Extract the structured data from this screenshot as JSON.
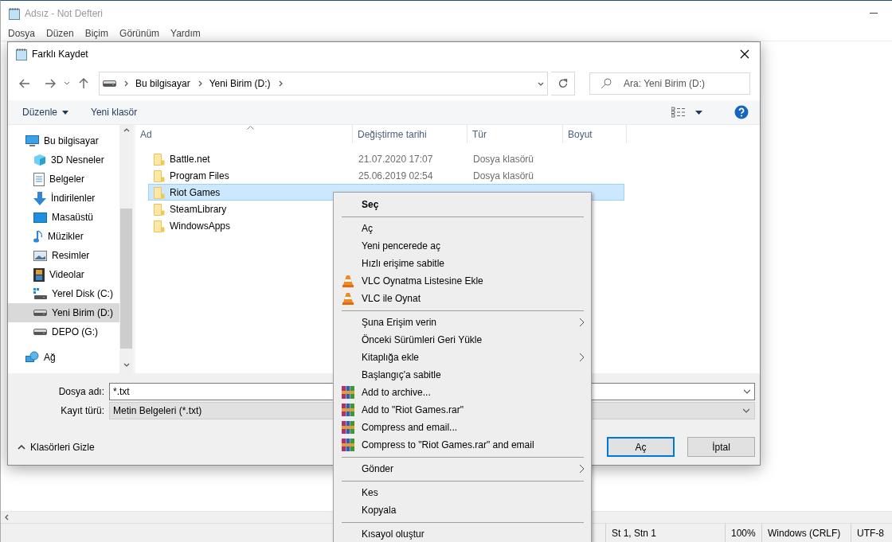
{
  "notepad": {
    "title": "Adsız - Not Defteri",
    "menu": [
      "Dosya",
      "Düzen",
      "Biçim",
      "Görünüm",
      "Yardım"
    ],
    "status": [
      "St 1, Stn 1",
      "100%",
      "Windows (CRLF)",
      "UTF-8"
    ]
  },
  "dialog": {
    "title": "Farklı Kaydet",
    "breadcrumbs": [
      "Bu bilgisayar",
      "Yeni Birim (D:)"
    ],
    "search_placeholder": "Ara: Yeni Birim (D:)",
    "toolbar": [
      "Düzenle",
      "Yeni klasör"
    ],
    "nav": [
      {
        "label": "Bu bilgisayar",
        "kind": "computer",
        "selected": false,
        "children": [
          {
            "label": "3D Nesneler",
            "kind": "cube",
            "selected": false
          },
          {
            "label": "Belgeler",
            "kind": "document",
            "selected": false
          },
          {
            "label": "İndirilenler",
            "kind": "download",
            "selected": false
          },
          {
            "label": "Masaüstü",
            "kind": "desktop",
            "selected": false
          },
          {
            "label": "Müzikler",
            "kind": "music",
            "selected": false
          },
          {
            "label": "Resimler",
            "kind": "pictures",
            "selected": false
          },
          {
            "label": "Videolar",
            "kind": "video",
            "selected": false
          },
          {
            "label": "Yerel Disk (C:)",
            "kind": "system-drive",
            "selected": false
          },
          {
            "label": "Yeni Birim (D:)",
            "kind": "drive",
            "selected": true
          },
          {
            "label": "DEPO (G:)",
            "kind": "drive",
            "selected": false
          }
        ]
      },
      {
        "label": "Ağ",
        "kind": "network",
        "selected": false
      }
    ],
    "columns": [
      "Ad",
      "Değiştirme tarihi",
      "Tür",
      "Boyut"
    ],
    "files": [
      {
        "name": "Battle.net",
        "modified": "21.07.2020 17:07",
        "type": "Dosya klasörü",
        "selected": false
      },
      {
        "name": "Program Files",
        "modified": "25.06.2019 02:54",
        "type": "Dosya klasörü",
        "selected": false
      },
      {
        "name": "Riot Games",
        "selected": true
      },
      {
        "name": "SteamLibrary",
        "selected": false
      },
      {
        "name": "WindowsApps",
        "selected": false
      }
    ],
    "file_name": {
      "label": "Dosya adı:",
      "value": "*.txt"
    },
    "file_type": {
      "label": "Kayıt türü:",
      "value": "Metin Belgeleri (*.txt)"
    },
    "hide_folders": "Klasörleri Gizle",
    "buttons": [
      {
        "label": "Aç",
        "default": true
      },
      {
        "label": "İptal",
        "default": false
      }
    ]
  },
  "context_menu": {
    "items": [
      {
        "kind": "entry",
        "label": "Seç",
        "default": true,
        "submenu": false
      },
      {
        "kind": "separator"
      },
      {
        "kind": "entry",
        "label": "Aç",
        "default": false,
        "submenu": false
      },
      {
        "kind": "entry",
        "label": "Yeni pencerede aç",
        "default": false,
        "submenu": false
      },
      {
        "kind": "entry",
        "label": "Hızlı erişime sabitle",
        "default": false,
        "submenu": false
      },
      {
        "kind": "media",
        "label": "VLC Oynatma Listesine Ekle",
        "default": false,
        "submenu": false
      },
      {
        "kind": "media",
        "label": "VLC ile Oynat",
        "default": false,
        "submenu": false
      },
      {
        "kind": "separator"
      },
      {
        "kind": "entry",
        "label": "Şuna Erişim verin",
        "default": false,
        "submenu": true
      },
      {
        "kind": "entry",
        "label": "Önceki Sürümleri Geri Yükle",
        "default": false,
        "submenu": false
      },
      {
        "kind": "entry",
        "label": "Kitaplığa ekle",
        "default": false,
        "submenu": true
      },
      {
        "kind": "entry",
        "label": "Başlangıç'a sabitle",
        "default": false,
        "submenu": false
      },
      {
        "kind": "archive",
        "label": "Add to archive...",
        "default": false,
        "submenu": false
      },
      {
        "kind": "archive",
        "label": "Add to \"Riot Games.rar\"",
        "default": false,
        "submenu": false
      },
      {
        "kind": "archive",
        "label": "Compress and email...",
        "default": false,
        "submenu": false
      },
      {
        "kind": "archive",
        "label": "Compress to \"Riot Games.rar\" and email",
        "default": false,
        "submenu": false
      },
      {
        "kind": "separator"
      },
      {
        "kind": "entry",
        "label": "Gönder",
        "default": false,
        "submenu": true
      },
      {
        "kind": "separator"
      },
      {
        "kind": "entry",
        "label": "Kes",
        "default": false,
        "submenu": false
      },
      {
        "kind": "entry",
        "label": "Kopyala",
        "default": false,
        "submenu": false
      },
      {
        "kind": "separator"
      },
      {
        "kind": "entry",
        "label": "Kısayol oluştur",
        "default": false,
        "submenu": false
      }
    ]
  }
}
